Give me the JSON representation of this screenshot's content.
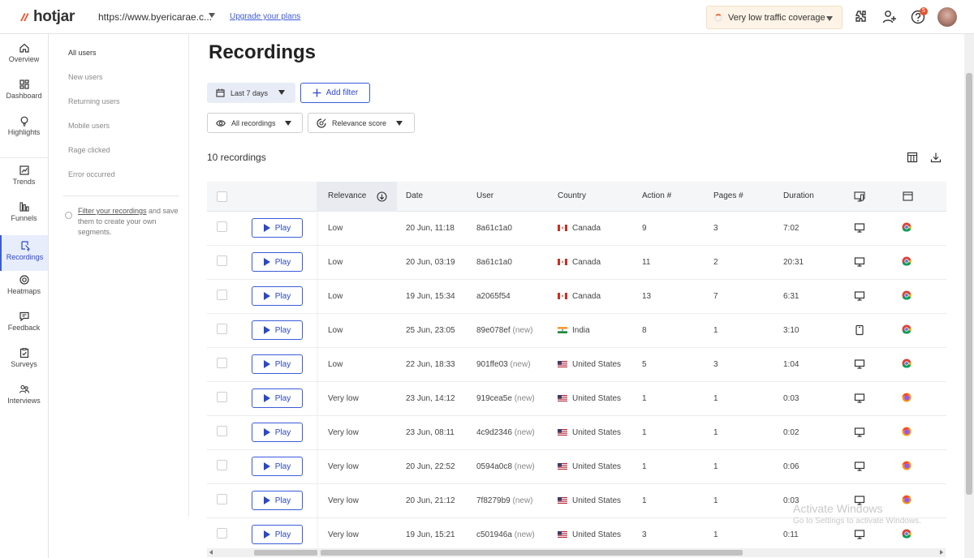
{
  "header": {
    "logo_text": "hotjar",
    "site_url": "https://www.byericarae.c...",
    "upgrade_link": "Upgrade your plans",
    "traffic_label": "Very low traffic coverage",
    "notifications_count": "5",
    "brand_color": "#f4532f",
    "accent_color": "#3b5bdb"
  },
  "leftnav": {
    "items": [
      {
        "label": "Overview",
        "icon": "home-icon"
      },
      {
        "label": "Dashboard",
        "icon": "dashboard-icon"
      },
      {
        "label": "Highlights",
        "icon": "lightbulb-icon"
      },
      {
        "label": "Trends",
        "icon": "trends-icon"
      },
      {
        "label": "Funnels",
        "icon": "funnels-icon"
      },
      {
        "label": "Recordings",
        "icon": "recordings-icon",
        "active": true
      },
      {
        "label": "Heatmaps",
        "icon": "heatmaps-icon"
      },
      {
        "label": "Feedback",
        "icon": "feedback-icon"
      },
      {
        "label": "Surveys",
        "icon": "surveys-icon"
      },
      {
        "label": "Interviews",
        "icon": "interviews-icon"
      }
    ]
  },
  "segments": {
    "items": [
      "All users",
      "New users",
      "Returning users",
      "Mobile users",
      "Rage clicked",
      "Error occurred"
    ],
    "note_link": "Filter your recordings",
    "note_text": " and save them to create your own segments."
  },
  "main": {
    "title": "Recordings",
    "date_filter": "Last 7 days",
    "add_filter": "Add filter",
    "recordings_filter": "All recordings",
    "sort_filter": "Relevance score",
    "count_label": "10 recordings"
  },
  "table": {
    "columns": [
      "Relevance",
      "Date",
      "User",
      "Country",
      "Action #",
      "Pages #",
      "Duration"
    ],
    "play_label": "Play",
    "new_tag": "(new)",
    "rows": [
      {
        "relevance": "Low",
        "date": "20 Jun, 11:18",
        "user": "8a61c1a0",
        "new": false,
        "country": "Canada",
        "flag": "ca",
        "actions": "9",
        "pages": "3",
        "duration": "7:02",
        "device": "desktop",
        "browser": "chrome"
      },
      {
        "relevance": "Low",
        "date": "20 Jun, 03:19",
        "user": "8a61c1a0",
        "new": false,
        "country": "Canada",
        "flag": "ca",
        "actions": "11",
        "pages": "2",
        "duration": "20:31",
        "device": "desktop",
        "browser": "chrome"
      },
      {
        "relevance": "Low",
        "date": "19 Jun, 15:34",
        "user": "a2065f54",
        "new": false,
        "country": "Canada",
        "flag": "ca",
        "actions": "13",
        "pages": "7",
        "duration": "6:31",
        "device": "desktop",
        "browser": "chrome"
      },
      {
        "relevance": "Low",
        "date": "25 Jun, 23:05",
        "user": "89e078ef",
        "new": true,
        "country": "India",
        "flag": "in",
        "actions": "8",
        "pages": "1",
        "duration": "3:10",
        "device": "tablet",
        "browser": "chrome"
      },
      {
        "relevance": "Low",
        "date": "22 Jun, 18:33",
        "user": "901ffe03",
        "new": true,
        "country": "United States",
        "flag": "us",
        "actions": "5",
        "pages": "3",
        "duration": "1:04",
        "device": "desktop",
        "browser": "chrome"
      },
      {
        "relevance": "Very low",
        "date": "23 Jun, 14:12",
        "user": "919cea5e",
        "new": true,
        "country": "United States",
        "flag": "us",
        "actions": "1",
        "pages": "1",
        "duration": "0:03",
        "device": "desktop",
        "browser": "firefox"
      },
      {
        "relevance": "Very low",
        "date": "23 Jun, 08:11",
        "user": "4c9d2346",
        "new": true,
        "country": "United States",
        "flag": "us",
        "actions": "1",
        "pages": "1",
        "duration": "0:02",
        "device": "desktop",
        "browser": "firefox"
      },
      {
        "relevance": "Very low",
        "date": "20 Jun, 22:52",
        "user": "0594a0c8",
        "new": true,
        "country": "United States",
        "flag": "us",
        "actions": "1",
        "pages": "1",
        "duration": "0:06",
        "device": "desktop",
        "browser": "firefox"
      },
      {
        "relevance": "Very low",
        "date": "20 Jun, 21:12",
        "user": "7f8279b9",
        "new": true,
        "country": "United States",
        "flag": "us",
        "actions": "1",
        "pages": "1",
        "duration": "0:03",
        "device": "desktop",
        "browser": "firefox"
      },
      {
        "relevance": "Very low",
        "date": "19 Jun, 15:21",
        "user": "c501946a",
        "new": true,
        "country": "United States",
        "flag": "us",
        "actions": "3",
        "pages": "1",
        "duration": "0:11",
        "device": "desktop",
        "browser": "chrome"
      }
    ]
  },
  "watermark": {
    "line1": "Activate Windows",
    "line2": "Go to Settings to activate Windows."
  }
}
